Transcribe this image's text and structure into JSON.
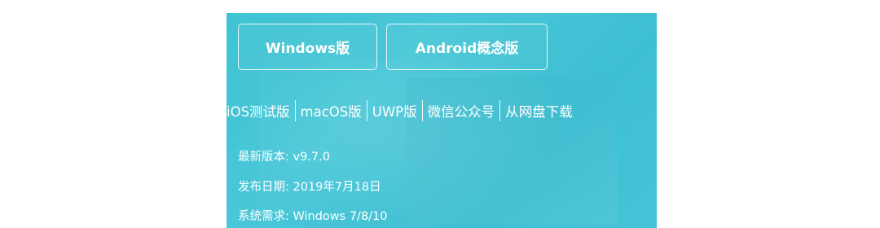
{
  "downloads": {
    "windows_label": "Windows版",
    "android_label": "Android概念版"
  },
  "links": [
    "iOS测试版",
    "macOS版",
    "UWP版",
    "微信公众号",
    "从网盘下载"
  ],
  "info": {
    "version": "最新版本: v9.7.0",
    "release_date": "发布日期: 2019年7月18日",
    "requirements": "系统需求: Windows 7/8/10"
  },
  "colors": {
    "panel_background": "#44c4d6",
    "text": "#ffffff"
  }
}
